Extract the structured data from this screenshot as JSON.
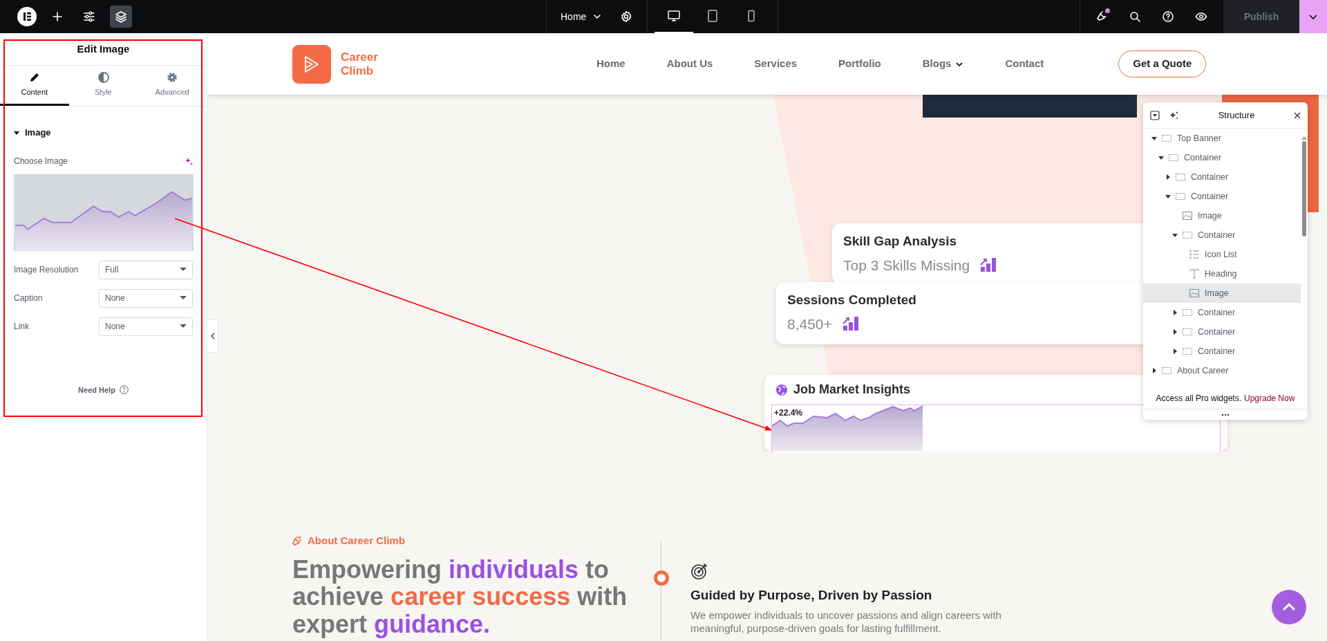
{
  "topbar": {
    "tools": [
      {
        "kind": "add",
        "selected": false
      },
      {
        "kind": "site-settings",
        "selected": false
      },
      {
        "kind": "structure",
        "selected": true
      }
    ],
    "page_menu": {
      "label": "Home"
    },
    "devices": [
      {
        "kind": "desktop",
        "selected": true
      },
      {
        "kind": "tablet",
        "selected": false
      },
      {
        "kind": "mobile",
        "selected": false
      }
    ],
    "actions": [
      {
        "kind": "whats-new",
        "unread": true
      },
      {
        "kind": "search",
        "unread": false
      },
      {
        "kind": "help",
        "unread": false
      },
      {
        "kind": "preview",
        "unread": false
      }
    ],
    "publish": {
      "label": "Publish",
      "disabled": true
    }
  },
  "panel": {
    "title": "Edit Image",
    "tabs": [
      {
        "kind": "content",
        "label": "Content",
        "selected": true
      },
      {
        "kind": "style",
        "label": "Style",
        "selected": false
      },
      {
        "kind": "advanced",
        "label": "Advanced",
        "selected": false
      }
    ],
    "section": {
      "title": "Image",
      "expanded": true
    },
    "choose_image_label": "Choose Image",
    "fields": [
      {
        "label": "Image Resolution",
        "value": "Full"
      },
      {
        "label": "Caption",
        "value": "None"
      },
      {
        "label": "Link",
        "value": "None"
      }
    ],
    "help": "Need Help"
  },
  "site": {
    "brand": "Career Climb",
    "nav": [
      {
        "label": "Home",
        "dropdown": false
      },
      {
        "label": "About Us",
        "dropdown": false
      },
      {
        "label": "Services",
        "dropdown": false
      },
      {
        "label": "Portfolio",
        "dropdown": false
      },
      {
        "label": "Blogs",
        "dropdown": true
      },
      {
        "label": "Contact",
        "dropdown": false
      }
    ],
    "cta": "Get a Quote",
    "cards": [
      {
        "kind": "stat",
        "title": "Skill Gap Analysis",
        "value": "Top 3 Skills Missing"
      },
      {
        "kind": "stat",
        "title": "Sessions Completed",
        "value": "8,450+"
      },
      {
        "kind": "chart",
        "title": "Job Market Insights",
        "value": "+22.4%"
      }
    ],
    "about": {
      "eyebrow": "About Career Climb",
      "heading": [
        {
          "text": "Empowering ",
          "color": "#777777"
        },
        {
          "text": "individuals",
          "color": "#9b51e0"
        },
        {
          "text": " to achieve ",
          "color": "#777777"
        },
        {
          "text": "career success",
          "color": "#f26b45"
        },
        {
          "text": " with expert ",
          "color": "#777777"
        },
        {
          "text": "guidance.",
          "color": "#9b51e0"
        }
      ],
      "feature_title": "Guided by Purpose, Driven by Passion",
      "feature_text": "We empower individuals to uncover passions and align careers with meaningful, purpose-driven goals for lasting fulfillment."
    }
  },
  "structure": {
    "title": "Structure",
    "tree": [
      {
        "kind": "container",
        "label": "Top Banner",
        "expanded": true,
        "selected": false,
        "children": [
          {
            "kind": "container",
            "label": "Container",
            "expanded": true,
            "selected": false,
            "children": [
              {
                "kind": "container",
                "label": "Container",
                "expanded": false,
                "selected": false
              },
              {
                "kind": "container",
                "label": "Container",
                "expanded": true,
                "selected": false,
                "children": [
                  {
                    "kind": "image",
                    "label": "Image",
                    "selected": false
                  },
                  {
                    "kind": "container",
                    "label": "Container",
                    "expanded": true,
                    "selected": false,
                    "children": [
                      {
                        "kind": "icon-list",
                        "label": "Icon List",
                        "selected": false
                      },
                      {
                        "kind": "heading",
                        "label": "Heading",
                        "selected": false
                      },
                      {
                        "kind": "image",
                        "label": "Image",
                        "selected": true
                      }
                    ]
                  },
                  {
                    "kind": "container",
                    "label": "Container",
                    "expanded": false,
                    "selected": false
                  },
                  {
                    "kind": "container",
                    "label": "Container",
                    "expanded": false,
                    "selected": false
                  },
                  {
                    "kind": "container",
                    "label": "Container",
                    "expanded": false,
                    "selected": false
                  }
                ]
              }
            ]
          }
        ]
      },
      {
        "kind": "container",
        "label": "About Career",
        "expanded": false,
        "selected": false
      }
    ],
    "notice": "Access all Pro widgets.",
    "notice_link": "Upgrade Now"
  }
}
